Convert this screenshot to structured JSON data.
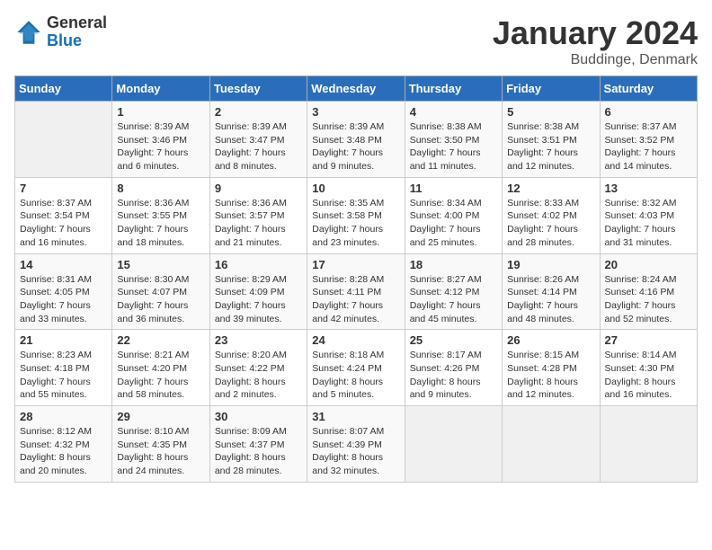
{
  "header": {
    "logo_general": "General",
    "logo_blue": "Blue",
    "month_title": "January 2024",
    "location": "Buddinge, Denmark"
  },
  "weekdays": [
    "Sunday",
    "Monday",
    "Tuesday",
    "Wednesday",
    "Thursday",
    "Friday",
    "Saturday"
  ],
  "weeks": [
    [
      {
        "day": "",
        "info": ""
      },
      {
        "day": "1",
        "info": "Sunrise: 8:39 AM\nSunset: 3:46 PM\nDaylight: 7 hours\nand 6 minutes."
      },
      {
        "day": "2",
        "info": "Sunrise: 8:39 AM\nSunset: 3:47 PM\nDaylight: 7 hours\nand 8 minutes."
      },
      {
        "day": "3",
        "info": "Sunrise: 8:39 AM\nSunset: 3:48 PM\nDaylight: 7 hours\nand 9 minutes."
      },
      {
        "day": "4",
        "info": "Sunrise: 8:38 AM\nSunset: 3:50 PM\nDaylight: 7 hours\nand 11 minutes."
      },
      {
        "day": "5",
        "info": "Sunrise: 8:38 AM\nSunset: 3:51 PM\nDaylight: 7 hours\nand 12 minutes."
      },
      {
        "day": "6",
        "info": "Sunrise: 8:37 AM\nSunset: 3:52 PM\nDaylight: 7 hours\nand 14 minutes."
      }
    ],
    [
      {
        "day": "7",
        "info": "Sunrise: 8:37 AM\nSunset: 3:54 PM\nDaylight: 7 hours\nand 16 minutes."
      },
      {
        "day": "8",
        "info": "Sunrise: 8:36 AM\nSunset: 3:55 PM\nDaylight: 7 hours\nand 18 minutes."
      },
      {
        "day": "9",
        "info": "Sunrise: 8:36 AM\nSunset: 3:57 PM\nDaylight: 7 hours\nand 21 minutes."
      },
      {
        "day": "10",
        "info": "Sunrise: 8:35 AM\nSunset: 3:58 PM\nDaylight: 7 hours\nand 23 minutes."
      },
      {
        "day": "11",
        "info": "Sunrise: 8:34 AM\nSunset: 4:00 PM\nDaylight: 7 hours\nand 25 minutes."
      },
      {
        "day": "12",
        "info": "Sunrise: 8:33 AM\nSunset: 4:02 PM\nDaylight: 7 hours\nand 28 minutes."
      },
      {
        "day": "13",
        "info": "Sunrise: 8:32 AM\nSunset: 4:03 PM\nDaylight: 7 hours\nand 31 minutes."
      }
    ],
    [
      {
        "day": "14",
        "info": "Sunrise: 8:31 AM\nSunset: 4:05 PM\nDaylight: 7 hours\nand 33 minutes."
      },
      {
        "day": "15",
        "info": "Sunrise: 8:30 AM\nSunset: 4:07 PM\nDaylight: 7 hours\nand 36 minutes."
      },
      {
        "day": "16",
        "info": "Sunrise: 8:29 AM\nSunset: 4:09 PM\nDaylight: 7 hours\nand 39 minutes."
      },
      {
        "day": "17",
        "info": "Sunrise: 8:28 AM\nSunset: 4:11 PM\nDaylight: 7 hours\nand 42 minutes."
      },
      {
        "day": "18",
        "info": "Sunrise: 8:27 AM\nSunset: 4:12 PM\nDaylight: 7 hours\nand 45 minutes."
      },
      {
        "day": "19",
        "info": "Sunrise: 8:26 AM\nSunset: 4:14 PM\nDaylight: 7 hours\nand 48 minutes."
      },
      {
        "day": "20",
        "info": "Sunrise: 8:24 AM\nSunset: 4:16 PM\nDaylight: 7 hours\nand 52 minutes."
      }
    ],
    [
      {
        "day": "21",
        "info": "Sunrise: 8:23 AM\nSunset: 4:18 PM\nDaylight: 7 hours\nand 55 minutes."
      },
      {
        "day": "22",
        "info": "Sunrise: 8:21 AM\nSunset: 4:20 PM\nDaylight: 7 hours\nand 58 minutes."
      },
      {
        "day": "23",
        "info": "Sunrise: 8:20 AM\nSunset: 4:22 PM\nDaylight: 8 hours\nand 2 minutes."
      },
      {
        "day": "24",
        "info": "Sunrise: 8:18 AM\nSunset: 4:24 PM\nDaylight: 8 hours\nand 5 minutes."
      },
      {
        "day": "25",
        "info": "Sunrise: 8:17 AM\nSunset: 4:26 PM\nDaylight: 8 hours\nand 9 minutes."
      },
      {
        "day": "26",
        "info": "Sunrise: 8:15 AM\nSunset: 4:28 PM\nDaylight: 8 hours\nand 12 minutes."
      },
      {
        "day": "27",
        "info": "Sunrise: 8:14 AM\nSunset: 4:30 PM\nDaylight: 8 hours\nand 16 minutes."
      }
    ],
    [
      {
        "day": "28",
        "info": "Sunrise: 8:12 AM\nSunset: 4:32 PM\nDaylight: 8 hours\nand 20 minutes."
      },
      {
        "day": "29",
        "info": "Sunrise: 8:10 AM\nSunset: 4:35 PM\nDaylight: 8 hours\nand 24 minutes."
      },
      {
        "day": "30",
        "info": "Sunrise: 8:09 AM\nSunset: 4:37 PM\nDaylight: 8 hours\nand 28 minutes."
      },
      {
        "day": "31",
        "info": "Sunrise: 8:07 AM\nSunset: 4:39 PM\nDaylight: 8 hours\nand 32 minutes."
      },
      {
        "day": "",
        "info": ""
      },
      {
        "day": "",
        "info": ""
      },
      {
        "day": "",
        "info": ""
      }
    ]
  ]
}
